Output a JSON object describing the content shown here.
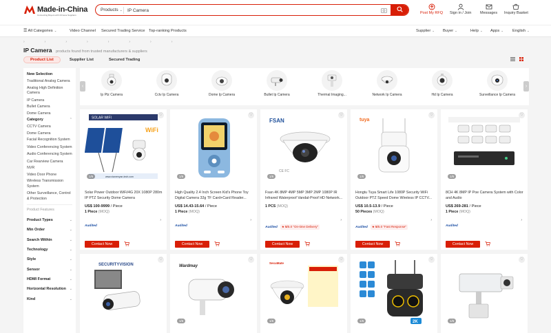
{
  "header": {
    "logo_text": "Made-in-China",
    "logo_tagline": "Connecting Buyers with Chinese Suppliers",
    "search_category": "Products",
    "search_value": "IP Camera",
    "post_rfq": "Post My RFQ",
    "sign_in": "Sign in / Join",
    "messages": "Messages",
    "basket": "Inquiry Basket"
  },
  "nav": {
    "all_categories": "All Categories",
    "video_channel": "Video Channel",
    "secured_trading": "Secured Trading Service",
    "top_ranking": "Top-ranking Products",
    "supplier": "Supplier",
    "buyer": "Buyer",
    "help": "Help",
    "apps": "Apps",
    "language": "English"
  },
  "breadcrumbs": [
    "›",
    "›",
    "›",
    "›",
    "›",
    "›",
    "›",
    "›"
  ],
  "page": {
    "title": "IP Camera",
    "subtitle": "products found from  trusted manufacturers & suppliers",
    "tabs": [
      "Product List",
      "Supplier List",
      "Secured Trading"
    ]
  },
  "sidebar": {
    "new_selection": "New Selection",
    "new_items": [
      "Traditional Analog Camera",
      "Analog High Definition Camera",
      "IP Camera",
      "Bullet Camera",
      "Dome Camera"
    ],
    "category": "Category",
    "category_items": [
      "CCTV Camera",
      "Dome Camera",
      "Facial Recognition System",
      "Video Conferencing System",
      "Audio Conferencing System",
      "Car Rearview Camera",
      "NVR",
      "Video Door Phone",
      "Wireless Transmission System",
      "Other Surveillance, Control & Protection"
    ],
    "product_features": "Product Features",
    "filters": [
      "Product Types",
      "Min Order",
      "Search Within",
      "Technology",
      "Style",
      "Sensor",
      "HDMI Format",
      "Horizontal Resolution",
      "Kind"
    ]
  },
  "carousel": [
    {
      "label": "Ip Ptz Camera",
      "icon": "ptz-camera-icon"
    },
    {
      "label": "Cctv Ip Camera",
      "icon": "cctv-camera-icon"
    },
    {
      "label": "Dome Ip Camera",
      "icon": "dome-camera-icon"
    },
    {
      "label": "Bullet Ip Camera",
      "icon": "bullet-camera-icon"
    },
    {
      "label": "Thermal Imaging...",
      "icon": "thermal-camera-icon"
    },
    {
      "label": "Network Ip Camera",
      "icon": "network-camera-icon"
    },
    {
      "label": "Hd Ip Camera",
      "icon": "hd-camera-icon"
    },
    {
      "label": "Surveillance Ip Camera",
      "icon": "surveillance-camera-icon"
    }
  ],
  "products": [
    {
      "title": "Solar Power Outdoor WiFi/4G 20X 1080P 280m IP PTZ Security Dome Camera",
      "price": "US$ 100-9999",
      "unit": "/ Piece",
      "moq": "1 Piece",
      "moq_note": "(MOQ)",
      "pager": "1/6",
      "badge": "",
      "score": "",
      "note": ""
    },
    {
      "title": "High Quality 2.4 Inch Screen Kid's Phone Toy Digital Camera 32g TF Card+Card Reader...",
      "price": "US$ 14.43-15.64",
      "unit": "/ Piece",
      "moq": "1 Piece",
      "moq_note": "(MOQ)",
      "pager": "1/6",
      "badge": "",
      "score": "",
      "note": ""
    },
    {
      "title": "Fsan 4K 8MP 4MP 5MP 3MP 2MP 1080P IR Infrared Waterproof Vandal-Proof HD Network...",
      "price": "",
      "unit": "",
      "moq": "1 PCS",
      "moq_note": "(MOQ)",
      "pager": "1/6",
      "badge": "5",
      "score": "/5.0",
      "note": "\"On-time Delivery\""
    },
    {
      "title": "Hongtu Tuya Smart Life 1080P Security WiFi Outdoor PTZ Speed Dome Wireless IP CCTV...",
      "price": "US$ 10.5-13.9",
      "unit": "/ Piece",
      "moq": "50 Pieces",
      "moq_note": "(MOQ)",
      "pager": "1/6",
      "badge": "5",
      "score": "/5.0",
      "note": "\"Fast Response\""
    },
    {
      "title": "8CH 4K 8MP IP Poe Camera System with Color and Audio",
      "price": "US$ 269-281",
      "unit": "/ Piece",
      "moq": "1 Piece",
      "moq_note": "(MOQ)",
      "pager": "1/6",
      "badge": "",
      "score": "",
      "note": ""
    }
  ],
  "row2_pagers": [
    "",
    "1/6",
    "1/6",
    "1/6",
    "1/6"
  ],
  "card_texts": {
    "audited": "Audited",
    "contact": "Contact Now",
    "img1_brand": "SOLAR WIFI",
    "img1_url": "www.xianrenyan-tech.com",
    "img3_brand": "FSAN",
    "img4_brand": "tuya",
    "img6_brand": "SECURITYVISION",
    "img7_brand": "Wardmay",
    "img8_brand": "SecuMate",
    "img9_badge": "2K"
  },
  "colors": {
    "brand_red": "#d81e06",
    "audited_blue": "#1b4ea3"
  }
}
